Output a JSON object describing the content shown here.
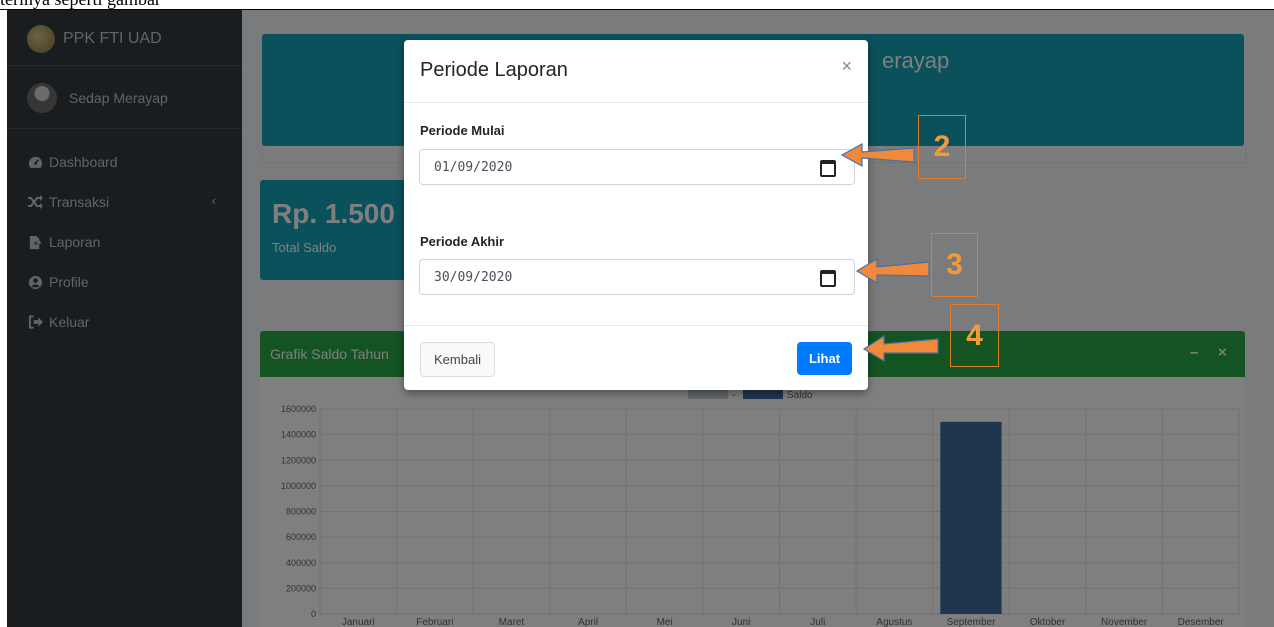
{
  "doc_strip": {
    "text": "terinya seperti gambar"
  },
  "sidebar": {
    "brand": "PPK FTI UAD",
    "user": "Sedap Merayap",
    "items": [
      {
        "label": "Dashboard",
        "icon": "tachometer-icon"
      },
      {
        "label": "Transaksi",
        "icon": "shuffle-icon",
        "caret": "‹"
      },
      {
        "label": "Laporan",
        "icon": "file-export-icon"
      },
      {
        "label": "Profile",
        "icon": "user-circle-icon"
      },
      {
        "label": "Keluar",
        "icon": "sign-out-icon"
      }
    ]
  },
  "main": {
    "hero_title": "erayap",
    "saldo_value": "Rp. 1.500",
    "saldo_label": "Total Saldo",
    "card_title": "Grafik Saldo Tahun",
    "card_tools": [
      "–",
      "×"
    ]
  },
  "chart_data": {
    "type": "bar",
    "legend": [
      "-",
      "Saldo"
    ],
    "categories": [
      "Januari",
      "Februari",
      "Maret",
      "April",
      "Mei",
      "Juni",
      "Juli",
      "Agustus",
      "September",
      "Oktober",
      "November",
      "Desember"
    ],
    "series": [
      {
        "name": "Saldo",
        "values": [
          0,
          0,
          0,
          0,
          0,
          0,
          0,
          0,
          1500000,
          0,
          0,
          0
        ]
      }
    ],
    "ylim": [
      0,
      1600000
    ],
    "yticks": [
      0,
      200000,
      400000,
      600000,
      800000,
      1000000,
      1200000,
      1400000,
      1600000
    ],
    "grid": true,
    "legend_position": "top",
    "colors": {
      "saldo": "#3c6e9a",
      "dash": "#c7ccd3"
    }
  },
  "modal": {
    "title": "Periode Laporan",
    "close": "×",
    "start_label": "Periode Mulai",
    "start_value": "01/09/2020",
    "end_label": "Periode Akhir",
    "end_value": "30/09/2020",
    "back_button": "Kembali",
    "view_button": "Lihat"
  },
  "annotations": [
    "2",
    "3",
    "4"
  ],
  "colors": {
    "sidebar": "#343a40",
    "info": "#17a2b8",
    "success": "#28a745",
    "primary": "#007bff",
    "annotation": "#e07b2a"
  }
}
